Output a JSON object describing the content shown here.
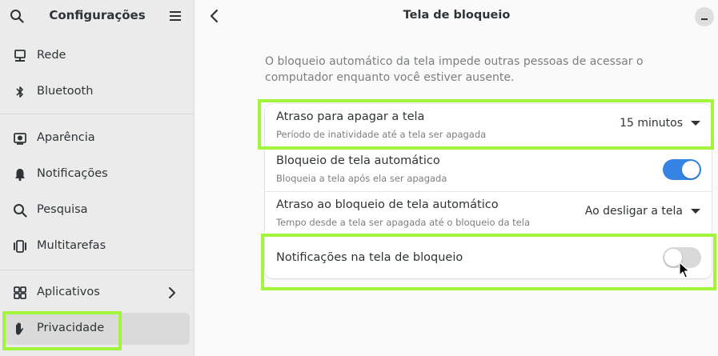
{
  "sidebar": {
    "title": "Configurações",
    "items": [
      {
        "label": "Rede",
        "icon": "network-icon"
      },
      {
        "label": "Bluetooth",
        "icon": "bluetooth-icon"
      },
      {
        "label": "Aparência",
        "icon": "appearance-icon"
      },
      {
        "label": "Notificações",
        "icon": "bell-icon"
      },
      {
        "label": "Pesquisa",
        "icon": "search-icon"
      },
      {
        "label": "Multitarefas",
        "icon": "multitasking-icon"
      },
      {
        "label": "Aplicativos",
        "icon": "apps-grid-icon"
      },
      {
        "label": "Privacidade",
        "icon": "hand-icon",
        "selected": true
      }
    ]
  },
  "header": {
    "title": "Tela de bloqueio"
  },
  "main": {
    "description": "O bloqueio automático da tela impede outras pessoas de acessar o computador enquanto você estiver ausente.",
    "rows": [
      {
        "title": "Atraso para apagar a tela",
        "subtitle": "Período de inatividade até a tela ser apagada",
        "value": "15 minutos"
      },
      {
        "title": "Bloqueio de tela automático",
        "subtitle": "Bloqueia a tela após ela ser apagada",
        "toggle": "on"
      },
      {
        "title": "Atraso ao bloqueio de tela automático",
        "subtitle": "Tempo desde a tela ser apagada até o bloqueio da tela",
        "value": "Ao desligar a tela"
      },
      {
        "title": "Notificações na tela de bloqueio",
        "toggle": "off"
      }
    ]
  },
  "colors": {
    "accent": "#3584e4",
    "highlight": "#a2f53a"
  }
}
